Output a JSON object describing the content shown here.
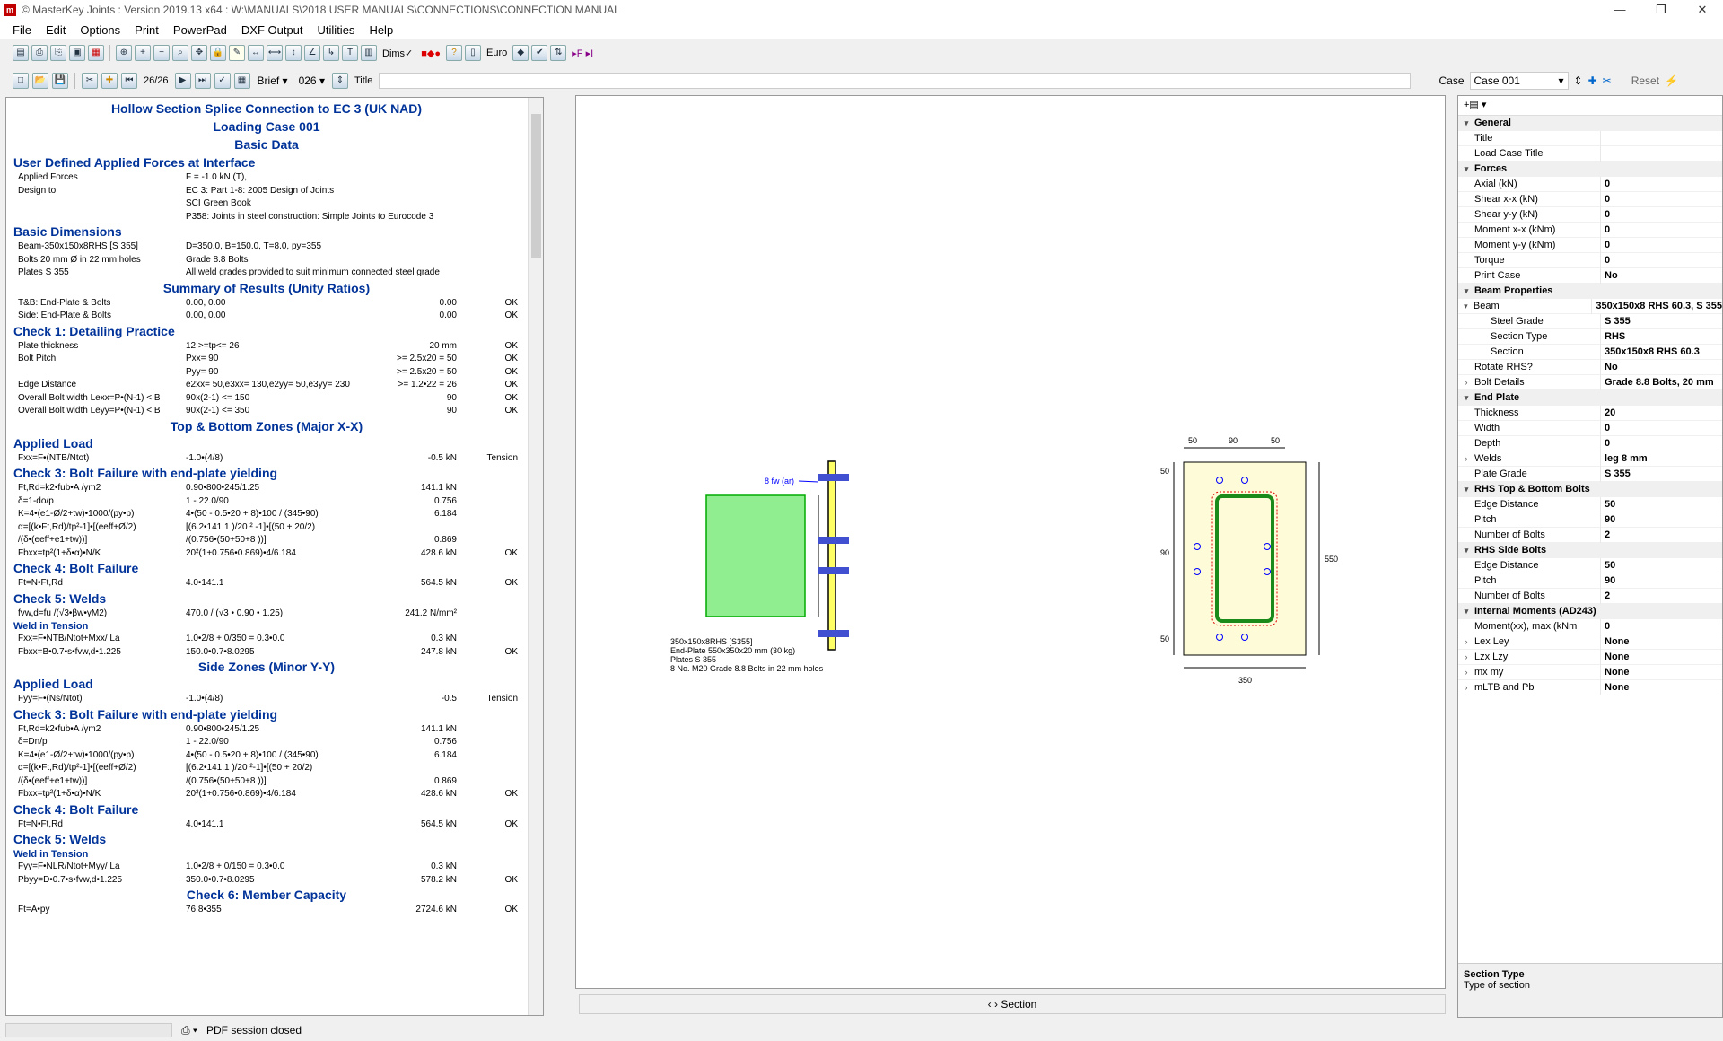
{
  "window": {
    "title": "© MasterKey Joints  : Version 2019.13 x64 : W:\\MANUALS\\2018 USER MANUALS\\CONNECTIONS\\CONNECTION MANUAL",
    "controls": [
      "—",
      "❐",
      "✕"
    ]
  },
  "menu": [
    "File",
    "Edit",
    "Options",
    "Print",
    "PowerPad",
    "DXF Output",
    "Utilities",
    "Help"
  ],
  "toolbar1": {
    "dims_label": "Dims✓",
    "euro_label": "Euro"
  },
  "toolbar2": {
    "page_label": "26/26",
    "brief_label": "Brief",
    "number_value": "026",
    "title_label": "Title",
    "case_label": "Case",
    "case_value": "Case 001",
    "reset_label": "Reset"
  },
  "report": {
    "title": "Hollow Section Splice Connection to EC 3 (UK NAD)",
    "loading_case": "Loading Case 001",
    "basic_data": "Basic Data",
    "sections": [
      {
        "kind": "h",
        "text": "User Defined Applied Forces at Interface"
      },
      {
        "kind": "row",
        "c1": "Applied Forces",
        "c2": "F = -1.0 kN (T),"
      },
      {
        "kind": "row",
        "c1": "Design to",
        "c2": "EC 3: Part 1-8: 2005 Design of Joints"
      },
      {
        "kind": "row",
        "c1": "",
        "c2": "SCI Green Book"
      },
      {
        "kind": "row",
        "c1": "",
        "c2": "P358: Joints in steel construction: Simple Joints to Eurocode 3"
      },
      {
        "kind": "h",
        "text": "Basic Dimensions"
      },
      {
        "kind": "row",
        "c1": "Beam-350x150x8RHS [S 355]",
        "c2": "D=350.0, B=150.0, T=8.0, py=355"
      },
      {
        "kind": "row",
        "c1": "Bolts 20 mm Ø in 22 mm holes",
        "c2": "Grade 8.8 Bolts"
      },
      {
        "kind": "row",
        "c1": "Plates S 355",
        "c2": "All weld grades provided to suit minimum connected steel grade"
      },
      {
        "kind": "hc",
        "text": "Summary of Results (Unity Ratios)"
      },
      {
        "kind": "row",
        "c1": "T&B: End-Plate & Bolts",
        "c2": "0.00, 0.00",
        "c3": "0.00",
        "c4": "OK"
      },
      {
        "kind": "row",
        "c1": "Side: End-Plate & Bolts",
        "c2": "0.00, 0.00",
        "c3": "0.00",
        "c4": "OK"
      },
      {
        "kind": "h",
        "text": "Check 1: Detailing Practice"
      },
      {
        "kind": "row",
        "c1": "Plate thickness",
        "c2": "12 >=tp<= 26",
        "c3": "20 mm",
        "c4": "OK"
      },
      {
        "kind": "row",
        "c1": "Bolt Pitch",
        "c2": "Pxx= 90",
        "c3": ">= 2.5x20 = 50",
        "c4": "OK"
      },
      {
        "kind": "row",
        "c1": "",
        "c2": "Pyy= 90",
        "c3": ">= 2.5x20 = 50",
        "c4": "OK"
      },
      {
        "kind": "row",
        "c1": "Edge Distance",
        "c2": "e2xx= 50,e3xx= 130,e2yy= 50,e3yy= 230",
        "c3": ">= 1.2•22 = 26",
        "c4": "OK"
      },
      {
        "kind": "row",
        "c1": "Overall Bolt width Lexx=P•(N-1) < B",
        "c2": "90x(2-1) <= 150",
        "c3": "90",
        "c4": "OK"
      },
      {
        "kind": "row",
        "c1": "Overall Bolt width Leyy=P•(N-1) < B",
        "c2": "90x(2-1) <= 350",
        "c3": "90",
        "c4": "OK"
      },
      {
        "kind": "hc",
        "text": "Top & Bottom Zones (Major X-X)"
      },
      {
        "kind": "h",
        "text": "Applied Load"
      },
      {
        "kind": "row",
        "c1": "Fxx=F•(NTB/Ntot)",
        "c2": "-1.0•(4/8)",
        "c3": "-0.5 kN",
        "c4": "Tension"
      },
      {
        "kind": "h",
        "text": "Check 3: Bolt Failure with end-plate yielding"
      },
      {
        "kind": "row",
        "c1": "Ft,Rd=k2•fub•A /γm2",
        "c2": "0.90•800•245/1.25",
        "c3": "141.1 kN"
      },
      {
        "kind": "row",
        "c1": "δ=1-do/p",
        "c2": "1 - 22.0/90",
        "c3": "0.756"
      },
      {
        "kind": "row",
        "c1": "K=4•(e1-Ø/2+tw)•1000/(py•p)",
        "c2": "4•(50 - 0.5•20 + 8)•100 / (345•90)",
        "c3": "6.184"
      },
      {
        "kind": "row",
        "c1": "α=[(k•Ft,Rd)/tp²-1]•[(eeff+Ø/2)",
        "c2": "[(6.2•141.1 )/20 ² -1]•[(50 + 20/2)",
        "c3": ""
      },
      {
        "kind": "row",
        "c1": "/(δ•(eeff+e1+tw))]",
        "c2": "/(0.756•(50+50+8 ))]",
        "c3": "0.869"
      },
      {
        "kind": "row",
        "c1": "Fbxx=tp²(1+δ•α)•N/K",
        "c2": "20²(1+0.756•0.869)•4/6.184",
        "c3": "428.6 kN",
        "c4": "OK"
      },
      {
        "kind": "h",
        "text": "Check 4: Bolt Failure"
      },
      {
        "kind": "row",
        "c1": "Ft=N•Ft,Rd",
        "c2": "4.0•141.1",
        "c3": "564.5 kN",
        "c4": "OK"
      },
      {
        "kind": "h",
        "text": "Check 5: Welds"
      },
      {
        "kind": "row",
        "c1": "fvw,d=fu /(√3•βw•γM2)",
        "c2": "470.0 / (√3 • 0.90 • 1.25)",
        "c3": "241.2 N/mm²"
      },
      {
        "kind": "sub",
        "text": "Weld in Tension"
      },
      {
        "kind": "row",
        "c1": "Fxx=F•NTB/Ntot+Mxx/ La",
        "c2": "1.0•2/8 + 0/350 = 0.3•0.0",
        "c3": "0.3 kN"
      },
      {
        "kind": "row",
        "c1": "Fbxx=B•0.7•s•fvw,d•1.225",
        "c2": "150.0•0.7•8.0295",
        "c3": "247.8 kN",
        "c4": "OK"
      },
      {
        "kind": "hc",
        "text": "Side Zones (Minor Y-Y)"
      },
      {
        "kind": "h",
        "text": "Applied Load"
      },
      {
        "kind": "row",
        "c1": "Fyy=F•(Ns/Ntot)",
        "c2": "-1.0•(4/8)",
        "c3": "-0.5",
        "c4": "Tension"
      },
      {
        "kind": "h",
        "text": "Check 3: Bolt Failure with end-plate yielding"
      },
      {
        "kind": "row",
        "c1": "Ft,Rd=k2•fub•A /γm2",
        "c2": "0.90•800•245/1.25",
        "c3": "141.1 kN"
      },
      {
        "kind": "row",
        "c1": "δ=Dn/p",
        "c2": "1 - 22.0/90",
        "c3": "0.756"
      },
      {
        "kind": "row",
        "c1": "K=4•(e1-Ø/2+tw)•1000/(py•p)",
        "c2": "4•(50 - 0.5•20 + 8)•100 / (345•90)",
        "c3": "6.184"
      },
      {
        "kind": "row",
        "c1": "α=[(k•Ft,Rd)/tp²-1]•[(eeff+Ø/2)",
        "c2": "[(6.2•141.1 )/20 ²-1]•[(50 + 20/2)",
        "c3": ""
      },
      {
        "kind": "row",
        "c1": "/(δ•(eeff+e1+tw))]",
        "c2": "/(0.756•(50+50+8 ))]",
        "c3": "0.869"
      },
      {
        "kind": "row",
        "c1": "Fbxx=tp²(1+δ•α)•N/K",
        "c2": "20²(1+0.756•0.869)•4/6.184",
        "c3": "428.6 kN",
        "c4": "OK"
      },
      {
        "kind": "h",
        "text": "Check 4: Bolt Failure"
      },
      {
        "kind": "row",
        "c1": "Ft=N•Ft,Rd",
        "c2": "4.0•141.1",
        "c3": "564.5 kN",
        "c4": "OK"
      },
      {
        "kind": "h",
        "text": "Check 5: Welds"
      },
      {
        "kind": "sub",
        "text": "Weld in Tension"
      },
      {
        "kind": "row",
        "c1": "Fyy=F•NLR/Ntot+Myy/ La",
        "c2": "1.0•2/8 + 0/150 = 0.3•0.0",
        "c3": "0.3 kN"
      },
      {
        "kind": "row",
        "c1": "Pbyy=D•0.7•s•fvw,d•1.225",
        "c2": "350.0•0.7•8.0295",
        "c3": "578.2 kN",
        "c4": "OK"
      },
      {
        "kind": "hc",
        "text": "Check 6: Member Capacity"
      },
      {
        "kind": "row",
        "c1": "Ft=A•py",
        "c2": "76.8•355",
        "c3": "2724.6 kN",
        "c4": "OK"
      }
    ]
  },
  "drawing": {
    "weld_label": "8 fw (ar)",
    "notes": [
      "350x150x8RHS [S355]",
      "End-Plate 550x350x20 mm (30 kg)",
      "Plates S 355",
      "8 No. M20 Grade 8.8 Bolts in 22 mm holes"
    ],
    "dims_top": [
      "50",
      "90",
      "50"
    ],
    "dims_left": [
      "50",
      "90",
      "50"
    ],
    "dim_right": "550",
    "dim_bottom": "350",
    "plate_color": "#fdfbd8",
    "section_color": "#1a8a1a",
    "beam_fill": "#90ee90"
  },
  "canvas_bottom": {
    "label": "Section",
    "arrows": "‹ ›"
  },
  "properties": {
    "toolbar": "+▤ ▾",
    "rows": [
      {
        "type": "cat",
        "k": "General"
      },
      {
        "k": "Title",
        "v": ""
      },
      {
        "k": "Load Case Title",
        "v": ""
      },
      {
        "type": "cat",
        "k": "Forces"
      },
      {
        "k": "Axial (kN)",
        "v": "0"
      },
      {
        "k": "Shear x-x (kN)",
        "v": "0"
      },
      {
        "k": "Shear y-y (kN)",
        "v": "0"
      },
      {
        "k": "Moment x-x (kNm)",
        "v": "0"
      },
      {
        "k": "Moment y-y (kNm)",
        "v": "0"
      },
      {
        "k": "Torque",
        "v": "0"
      },
      {
        "k": "Print Case",
        "v": "No"
      },
      {
        "type": "cat",
        "k": "Beam Properties"
      },
      {
        "k": "Beam",
        "v": "350x150x8 RHS 60.3, S 355",
        "exp": "▾"
      },
      {
        "k": "Steel Grade",
        "v": "S 355",
        "indent": true
      },
      {
        "k": "Section Type",
        "v": "RHS",
        "indent": true
      },
      {
        "k": "Section",
        "v": "350x150x8 RHS 60.3",
        "indent": true
      },
      {
        "k": "Rotate RHS?",
        "v": "No"
      },
      {
        "k": "Bolt Details",
        "v": "Grade 8.8 Bolts, 20 mm",
        "exp": "›"
      },
      {
        "type": "cat",
        "k": "End Plate"
      },
      {
        "k": "Thickness",
        "v": "20"
      },
      {
        "k": "Width",
        "v": "0"
      },
      {
        "k": "Depth",
        "v": "0"
      },
      {
        "k": "Welds",
        "v": "leg 8 mm",
        "exp": "›"
      },
      {
        "k": "Plate Grade",
        "v": "S 355"
      },
      {
        "type": "cat",
        "k": "RHS Top & Bottom Bolts"
      },
      {
        "k": "Edge Distance",
        "v": "50"
      },
      {
        "k": "Pitch",
        "v": "90"
      },
      {
        "k": "Number of Bolts",
        "v": "2"
      },
      {
        "type": "cat",
        "k": "RHS Side Bolts"
      },
      {
        "k": "Edge Distance",
        "v": "50"
      },
      {
        "k": "Pitch",
        "v": "90"
      },
      {
        "k": "Number of Bolts",
        "v": "2"
      },
      {
        "type": "cat",
        "k": "Internal Moments (AD243)"
      },
      {
        "k": "Moment(xx), max (kNm",
        "v": "0"
      },
      {
        "k": "Lex   Ley",
        "v": "None",
        "exp": "›"
      },
      {
        "k": "Lzx   Lzy",
        "v": "None",
        "exp": "›"
      },
      {
        "k": "mx    my",
        "v": "None",
        "exp": "›"
      },
      {
        "k": "mLTB and Pb",
        "v": "None",
        "exp": "›"
      }
    ],
    "help_title": "Section Type",
    "help_text": "Type of section"
  },
  "status": {
    "text": "PDF session closed"
  }
}
